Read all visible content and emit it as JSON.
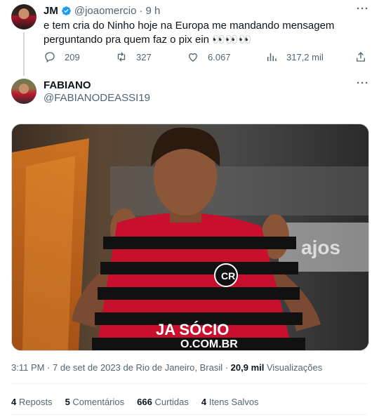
{
  "tweet": {
    "author_name": "JM",
    "author_handle": "@joaomercio",
    "separator": "·",
    "time_ago": "9 h",
    "text": "e tem cria do Ninho hoje na Europa me mandando mensagem perguntando pra quem faz o pix ein 👀👀👀",
    "actions": {
      "replies": "209",
      "retweets": "327",
      "likes": "6.067",
      "views": "317,2 mil"
    }
  },
  "main_tweet": {
    "author_name": "FABIANO",
    "author_handle": "@FABIANODEASSI19",
    "image_shirt_text_1": "JA SÓCIO",
    "image_shirt_text_2": "O.COM.BR",
    "image_bg_text": "ajos",
    "timestamp": "3:11 PM · 7 de set de 2023 de Rio de Janeiro, Brasil · ",
    "views_count": "20,9 mil",
    "views_label": " Visualizações",
    "stats": {
      "reposts_count": "4",
      "reposts_label": "Reposts",
      "comments_count": "5",
      "comments_label": "Comentários",
      "likes_count": "666",
      "likes_label": "Curtidas",
      "saves_count": "4",
      "saves_label": "Itens Salvos"
    }
  },
  "colors": {
    "verified_blue": "#1d9bf0",
    "muted": "#536471",
    "text": "#0f1419",
    "flamengo_red": "#c8102e"
  }
}
